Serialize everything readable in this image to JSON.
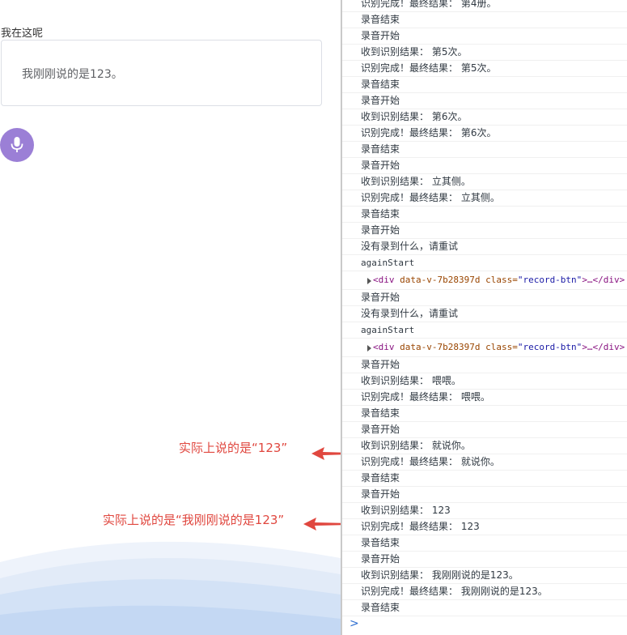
{
  "app": {
    "label": "我在这呢",
    "input_value": "我刚刚说的是123。",
    "record_button_icon": "microphone-icon"
  },
  "annotations": [
    {
      "text": "实际上说的是“123”"
    },
    {
      "text": "实际上说的是“我刚刚说的是123”"
    }
  ],
  "console": {
    "logs": [
      {
        "type": "text",
        "text": "识别完成！最终结果： 第4册。"
      },
      {
        "type": "text",
        "text": "录音结束"
      },
      {
        "type": "text",
        "text": "录音开始"
      },
      {
        "type": "text",
        "text": "收到识别结果： 第5次。"
      },
      {
        "type": "text",
        "text": "识别完成！最终结果： 第5次。"
      },
      {
        "type": "text",
        "text": "录音结束"
      },
      {
        "type": "text",
        "text": "录音开始"
      },
      {
        "type": "text",
        "text": "收到识别结果： 第6次。"
      },
      {
        "type": "text",
        "text": "识别完成！最终结果： 第6次。"
      },
      {
        "type": "text",
        "text": "录音结束"
      },
      {
        "type": "text",
        "text": "录音开始"
      },
      {
        "type": "text",
        "text": "收到识别结果： 立其侧。"
      },
      {
        "type": "text",
        "text": "识别完成！最终结果： 立其侧。"
      },
      {
        "type": "text",
        "text": "录音结束"
      },
      {
        "type": "text",
        "text": "录音开始"
      },
      {
        "type": "text",
        "text": "没有录到什么，请重试"
      },
      {
        "type": "mono",
        "text": "againStart"
      },
      {
        "type": "node",
        "tag_open": "<div",
        "attr1": " data-v-7b28397d",
        "attr2": " class=",
        "val": "\"record-btn\"",
        "tag_close": ">…</div>"
      },
      {
        "type": "text",
        "text": "录音开始"
      },
      {
        "type": "text",
        "text": "没有录到什么，请重试"
      },
      {
        "type": "mono",
        "text": "againStart"
      },
      {
        "type": "node",
        "tag_open": "<div",
        "attr1": " data-v-7b28397d",
        "attr2": " class=",
        "val": "\"record-btn\"",
        "tag_close": ">…</div>"
      },
      {
        "type": "text",
        "text": "录音开始"
      },
      {
        "type": "text",
        "text": "收到识别结果： 喂喂。"
      },
      {
        "type": "text",
        "text": "识别完成！最终结果： 喂喂。"
      },
      {
        "type": "text",
        "text": "录音结束"
      },
      {
        "type": "text",
        "text": "录音开始"
      },
      {
        "type": "text",
        "text": "收到识别结果： 就说你。"
      },
      {
        "type": "text",
        "text": "识别完成！最终结果： 就说你。"
      },
      {
        "type": "text",
        "text": "录音结束"
      },
      {
        "type": "text",
        "text": "录音开始"
      },
      {
        "type": "text",
        "text": "收到识别结果： 123"
      },
      {
        "type": "text",
        "text": "识别完成！最终结果： 123"
      },
      {
        "type": "text",
        "text": "录音结束"
      },
      {
        "type": "text",
        "text": "录音开始"
      },
      {
        "type": "text",
        "text": "收到识别结果： 我刚刚说的是123。"
      },
      {
        "type": "text",
        "text": "识别完成！最终结果： 我刚刚说的是123。"
      },
      {
        "type": "text",
        "text": "录音结束"
      }
    ],
    "prompt_symbol": ">"
  },
  "colors": {
    "annotation_red": "#e0473f",
    "record_button": "#9b7fd6",
    "node_tag": "#881280",
    "node_attr": "#994500",
    "node_value": "#1a1aa6"
  }
}
